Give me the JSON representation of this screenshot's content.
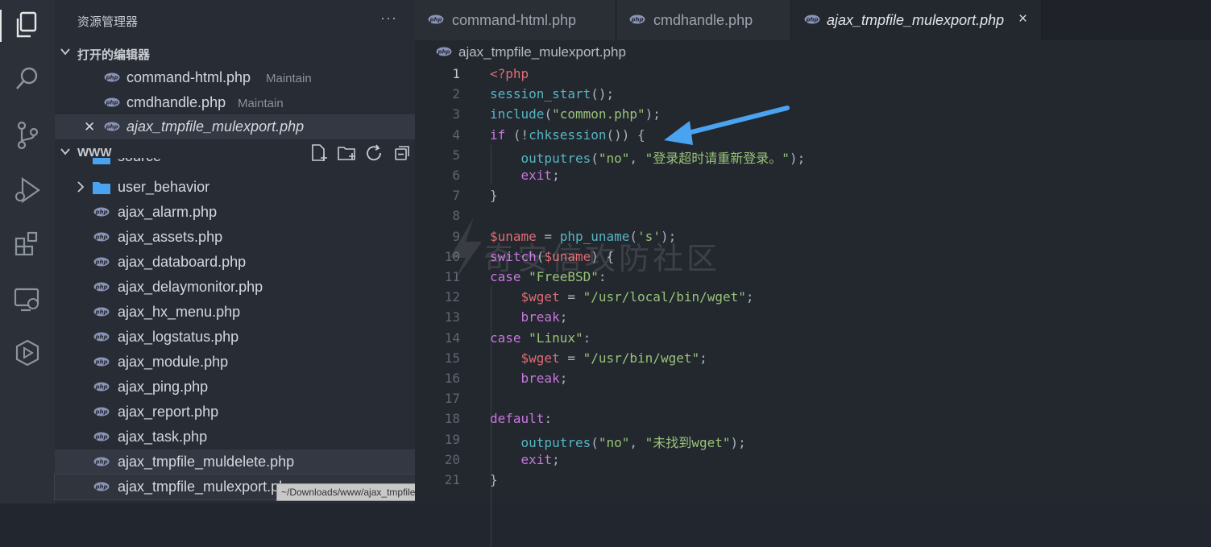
{
  "explorer": {
    "title": "资源管理器",
    "more": "···",
    "open_editors": {
      "label": "打开的编辑器",
      "items": [
        {
          "name": "command-html.php",
          "desc": "Maintain"
        },
        {
          "name": "cmdhandle.php",
          "desc": "Maintain"
        },
        {
          "name": "ajax_tmpfile_mulexport.php",
          "desc": ""
        }
      ]
    },
    "folder": {
      "label": "WWW",
      "partial_item": "source",
      "subfolder": "user_behavior",
      "files": [
        "ajax_alarm.php",
        "ajax_assets.php",
        "ajax_databoard.php",
        "ajax_delaymonitor.php",
        "ajax_hx_menu.php",
        "ajax_logstatus.php",
        "ajax_module.php",
        "ajax_ping.php",
        "ajax_report.php",
        "ajax_task.php",
        "ajax_tmpfile_muldelete.php",
        "ajax_tmpfile_mulexport.php"
      ]
    },
    "tooltip": "~/Downloads/www/ajax_tmpfile_muldelete.php"
  },
  "tabs": [
    {
      "label": "command-html.php"
    },
    {
      "label": "cmdhandle.php"
    },
    {
      "label": "ajax_tmpfile_mulexport.php",
      "close": "×"
    }
  ],
  "breadcrumb": "ajax_tmpfile_mulexport.php",
  "code_lines": [
    {
      "n": "1",
      "parts": [
        [
          "t-red",
          "<?php"
        ]
      ]
    },
    {
      "n": "2",
      "parts": [
        [
          "t-cyan",
          "session_start"
        ],
        [
          "t-white",
          "();"
        ]
      ]
    },
    {
      "n": "3",
      "parts": [
        [
          "t-cyan",
          "include"
        ],
        [
          "t-white",
          "("
        ],
        [
          "t-green",
          "\"common.php\""
        ],
        [
          "t-white",
          ");"
        ]
      ]
    },
    {
      "n": "4",
      "parts": [
        [
          "t-purple",
          "if"
        ],
        [
          "t-white",
          " (!"
        ],
        [
          "t-cyan",
          "chksession"
        ],
        [
          "t-white",
          "()) {"
        ]
      ]
    },
    {
      "n": "5",
      "parts": [
        [
          "t-white",
          "    "
        ],
        [
          "t-cyan",
          "outputres"
        ],
        [
          "t-white",
          "("
        ],
        [
          "t-green",
          "\"no\""
        ],
        [
          "t-white",
          ", "
        ],
        [
          "t-green",
          "\"登录超时请重新登录。\""
        ],
        [
          "t-white",
          ");"
        ]
      ]
    },
    {
      "n": "6",
      "parts": [
        [
          "t-white",
          "    "
        ],
        [
          "t-purple",
          "exit"
        ],
        [
          "t-white",
          ";"
        ]
      ]
    },
    {
      "n": "7",
      "parts": [
        [
          "t-white",
          "}"
        ]
      ]
    },
    {
      "n": "8",
      "parts": []
    },
    {
      "n": "9",
      "parts": [
        [
          "t-red",
          "$uname"
        ],
        [
          "t-white",
          " = "
        ],
        [
          "t-cyan",
          "php_uname"
        ],
        [
          "t-white",
          "("
        ],
        [
          "t-green",
          "'s'"
        ],
        [
          "t-white",
          ");"
        ]
      ]
    },
    {
      "n": "10",
      "parts": [
        [
          "t-purple",
          "switch"
        ],
        [
          "t-white",
          "("
        ],
        [
          "t-red",
          "$uname"
        ],
        [
          "t-white",
          ") {"
        ]
      ]
    },
    {
      "n": "11",
      "parts": [
        [
          "t-purple",
          "case"
        ],
        [
          "t-white",
          " "
        ],
        [
          "t-green",
          "\"FreeBSD\""
        ],
        [
          "t-white",
          ":"
        ]
      ]
    },
    {
      "n": "12",
      "parts": [
        [
          "t-white",
          "    "
        ],
        [
          "t-red",
          "$wget"
        ],
        [
          "t-white",
          " = "
        ],
        [
          "t-green",
          "\"/usr/local/bin/wget\""
        ],
        [
          "t-white",
          ";"
        ]
      ]
    },
    {
      "n": "13",
      "parts": [
        [
          "t-white",
          "    "
        ],
        [
          "t-purple",
          "break"
        ],
        [
          "t-white",
          ";"
        ]
      ]
    },
    {
      "n": "14",
      "parts": [
        [
          "t-purple",
          "case"
        ],
        [
          "t-white",
          " "
        ],
        [
          "t-green",
          "\"Linux\""
        ],
        [
          "t-white",
          ":"
        ]
      ]
    },
    {
      "n": "15",
      "parts": [
        [
          "t-white",
          "    "
        ],
        [
          "t-red",
          "$wget"
        ],
        [
          "t-white",
          " = "
        ],
        [
          "t-green",
          "\"/usr/bin/wget\""
        ],
        [
          "t-white",
          ";"
        ]
      ]
    },
    {
      "n": "16",
      "parts": [
        [
          "t-white",
          "    "
        ],
        [
          "t-purple",
          "break"
        ],
        [
          "t-white",
          ";"
        ]
      ]
    },
    {
      "n": "17",
      "parts": []
    },
    {
      "n": "18",
      "parts": [
        [
          "t-purple",
          "default"
        ],
        [
          "t-white",
          ":"
        ]
      ]
    },
    {
      "n": "19",
      "parts": [
        [
          "t-white",
          "    "
        ],
        [
          "t-cyan",
          "outputres"
        ],
        [
          "t-white",
          "("
        ],
        [
          "t-green",
          "\"no\""
        ],
        [
          "t-white",
          ", "
        ],
        [
          "t-green",
          "\"未找到wget\""
        ],
        [
          "t-white",
          ");"
        ]
      ]
    },
    {
      "n": "20",
      "parts": [
        [
          "t-white",
          "    "
        ],
        [
          "t-purple",
          "exit"
        ],
        [
          "t-white",
          ";"
        ]
      ]
    },
    {
      "n": "21",
      "parts": [
        [
          "t-white",
          "}"
        ]
      ]
    }
  ],
  "watermark": "奇安信攻防社区",
  "colors": {
    "arrow": "#4aa3f0",
    "accent_red": "#e06c75",
    "string_green": "#98c379",
    "keyword_purple": "#c678dd",
    "function_cyan": "#56b6c2"
  }
}
